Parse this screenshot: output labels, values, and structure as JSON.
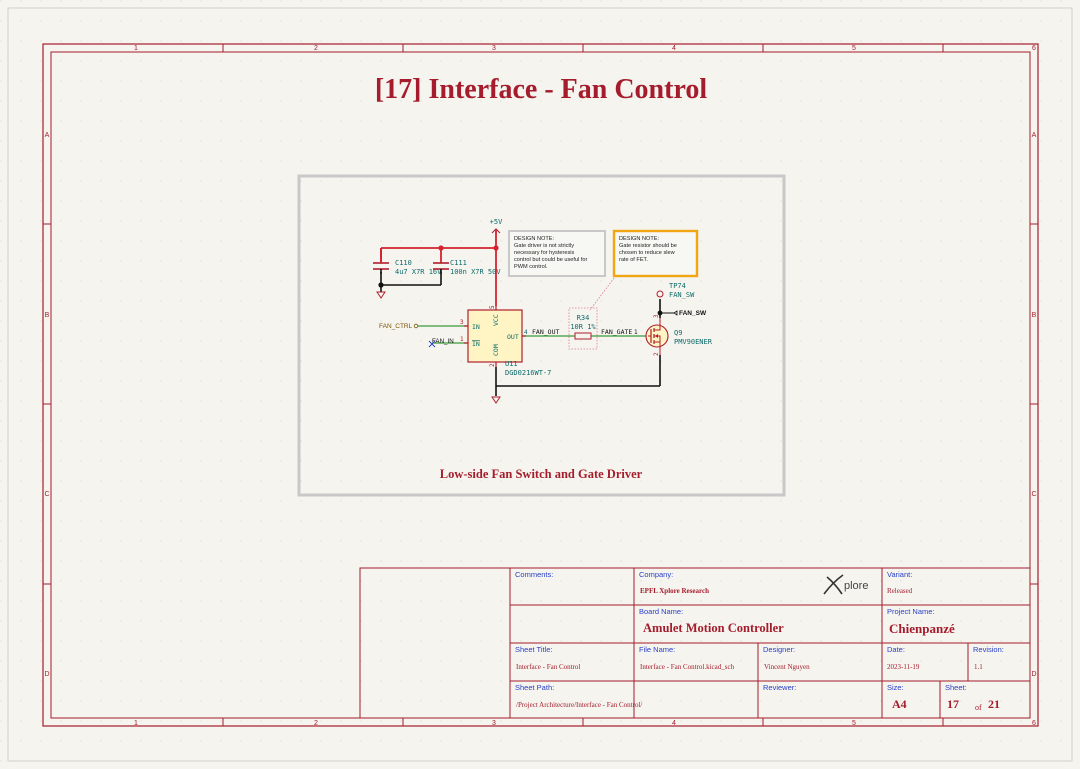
{
  "page": {
    "title": "[17] Interface - Fan Control",
    "frame_columns": [
      "1",
      "2",
      "3",
      "4",
      "5",
      "6"
    ],
    "frame_rows": [
      "A",
      "B",
      "C",
      "D"
    ]
  },
  "colors": {
    "border": "#a51d2d",
    "title_text": "#a51d2d",
    "power_wire": "#d4232f",
    "signal_wire": "#3a9b3a",
    "schematic_text": "#0e6b6b",
    "component_fill": "#fff5c4",
    "component_outline": "#b01e2e",
    "note_highlight": "#f1a614",
    "group_box": "#c8c8c8"
  },
  "schematic": {
    "group_title": "Low-side Fan Switch and Gate Driver",
    "power_label": "+5V",
    "c110": {
      "ref": "C110",
      "value": "4u7 X7R 16V"
    },
    "c111": {
      "ref": "C111",
      "value": "100n X7R 50V"
    },
    "u11": {
      "ref": "U11",
      "value": "DGD0216WT-7",
      "pin_in": "IN",
      "pin_inb": "IN",
      "pin_vcc": "VCC",
      "pin_com": "COM",
      "pin_out": "OUT",
      "num_in": "3",
      "num_inb": "1",
      "num_out": "4",
      "num_vcc": "5",
      "num_com": "2"
    },
    "r34": {
      "ref": "R34",
      "value": "10R 1%"
    },
    "q9": {
      "ref": "Q9",
      "value": "PMV90ENER",
      "num_g": "1",
      "num_d": "3",
      "num_s": "2"
    },
    "tp74": {
      "ref": "TP74",
      "value": "FAN_SW"
    },
    "nets": {
      "fan_ctrl": "FAN_CTRL",
      "fan_in": "FAN_IN",
      "fan_out": "FAN_OUT",
      "fan_gate": "FAN_GATE",
      "fan_sw": "FAN_SW"
    },
    "note1": [
      "DESIGN NOTE:",
      "Gate driver is not strictly",
      "necessary for hysteresis",
      "control but could be useful for",
      "PWM control."
    ],
    "note2": [
      "DESIGN NOTE:",
      "Gate resistor should be",
      "chosen to reduce slew",
      "rate of FET."
    ]
  },
  "title_block": {
    "comments_label": "Comments:",
    "company_label": "Company:",
    "company": "EPFL Xplore Research",
    "logo_text": "plore",
    "variant_label": "Variant:",
    "variant": "Released",
    "board_name_label": "Board Name:",
    "board_name": "Amulet Motion Controller",
    "project_name_label": "Project Name:",
    "project_name": "Chienpanzé",
    "sheet_title_label": "Sheet Title:",
    "sheet_title": "Interface - Fan Control",
    "file_name_label": "File Name:",
    "file_name": "Interface - Fan Control.kicad_sch",
    "designer_label": "Designer:",
    "designer": "Vincent Nguyen",
    "date_label": "Date:",
    "date": "2023-11-19",
    "revision_label": "Revision:",
    "revision": "1.1",
    "sheet_path_label": "Sheet Path:",
    "sheet_path": "/Project Architecture/Interface - Fan Control/",
    "reviewer_label": "Reviewer:",
    "size_label": "Size:",
    "size": "A4",
    "sheet_label": "Sheet:",
    "sheet_num": "17",
    "of_label": "of",
    "sheet_total": "21"
  }
}
